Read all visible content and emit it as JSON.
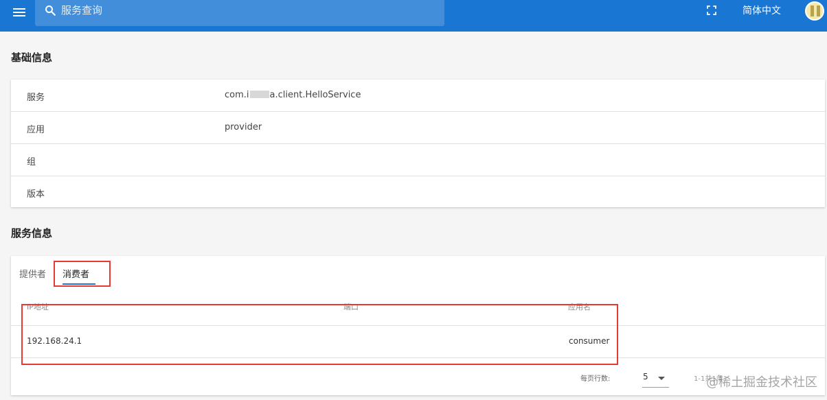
{
  "header": {
    "search_placeholder": "服务查询",
    "language_label": "简体中文",
    "icons": [
      "menu-icon",
      "search-icon",
      "fullscreen-icon",
      "avatar"
    ]
  },
  "basic_info": {
    "title": "基础信息",
    "rows": [
      {
        "label": "服务",
        "value_prefix": "com.i",
        "value_suffix": "a.client.HelloService"
      },
      {
        "label": "应用",
        "value": "provider"
      },
      {
        "label": "组",
        "value": ""
      },
      {
        "label": "版本",
        "value": ""
      }
    ]
  },
  "service_info": {
    "title": "服务信息",
    "tabs": [
      {
        "label": "提供者",
        "active": false
      },
      {
        "label": "消费者",
        "active": true
      }
    ],
    "columns": [
      "IP地址",
      "端口",
      "应用名"
    ],
    "rows": [
      {
        "ip": "192.168.24.1",
        "port": "",
        "app": "consumer"
      }
    ],
    "pagination": {
      "rows_per_page_label": "每页行数:",
      "rows_per_page": "5",
      "range_text": "1-1共1条"
    }
  },
  "watermark": "@稀土掘金技术社区",
  "colors": {
    "header_bg": "#1976d2",
    "highlight": "#e53935",
    "page_bg": "#f5f5f5"
  }
}
